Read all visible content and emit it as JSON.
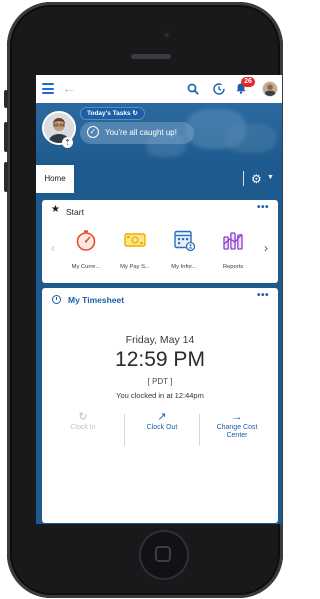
{
  "topbar": {
    "badge_count": "26"
  },
  "hero": {
    "tasks_label": "Today's Tasks",
    "caught_up_text": "You're all caught up!"
  },
  "tabs": {
    "home_label": "Home"
  },
  "start_card": {
    "title": "Start",
    "more": "•••",
    "tiles": [
      {
        "label": "My Curre...",
        "icon": "stopwatch-icon"
      },
      {
        "label": "My Pay S...",
        "icon": "money-icon"
      },
      {
        "label": "My Infor...",
        "icon": "info-calendar-icon"
      },
      {
        "label": "Reports",
        "icon": "reports-chart-icon"
      }
    ]
  },
  "timesheet": {
    "title": "My Timesheet",
    "more": "•••",
    "date": "Friday, May 14",
    "time": "12:59 PM",
    "timezone": "[ PDT ]",
    "clocked_status": "You clocked in at 12:44pm",
    "actions": {
      "clock_in": "Clock In",
      "clock_out": "Clock Out",
      "change_cost_center": "Change Cost Center"
    }
  },
  "colors": {
    "accent": "#1a5fa8",
    "header_band": "#1d5b8e",
    "badge": "#e02b2b",
    "disabled": "#b8c3cc"
  }
}
